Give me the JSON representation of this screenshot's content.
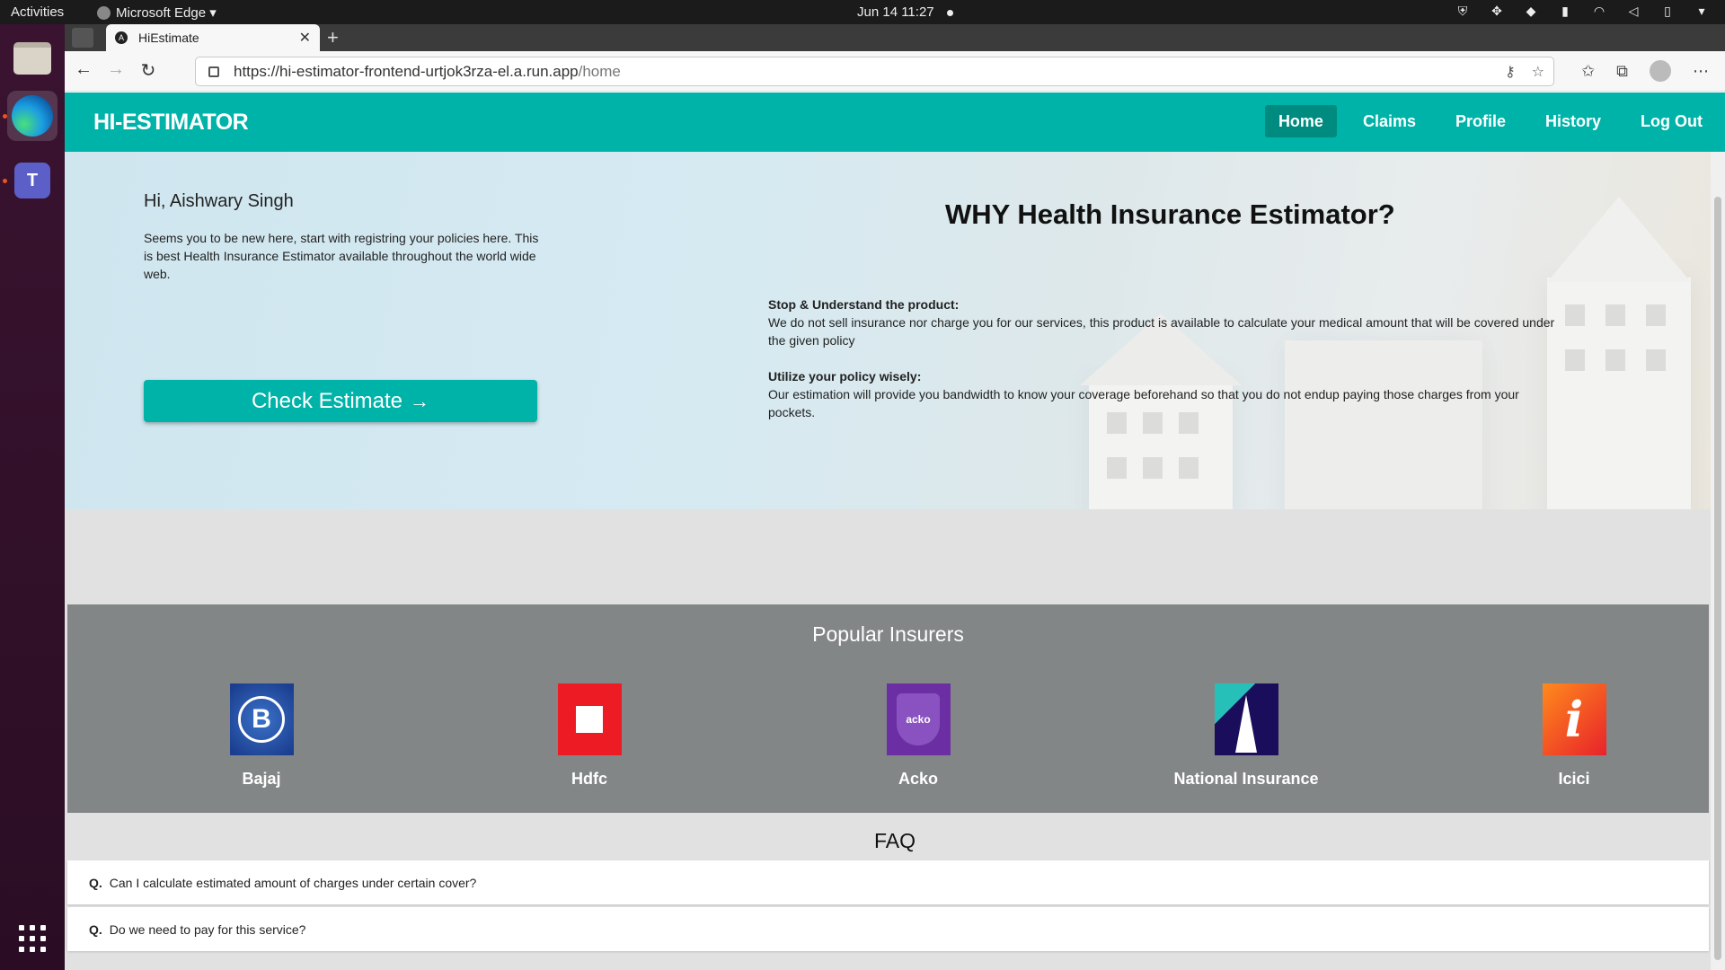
{
  "os": {
    "activities": "Activities",
    "app_menu": "Microsoft Edge ▾",
    "clock": "Jun 14  11:27"
  },
  "browser": {
    "tab_title": "HiEstimate",
    "url_host": "https://hi-estimator-frontend-urtjok3rza-el.a.run.app",
    "url_path": "/home"
  },
  "app": {
    "brand": "HI-ESTIMATOR",
    "nav": [
      "Home",
      "Claims",
      "Profile",
      "History",
      "Log Out"
    ],
    "active_nav": "Home",
    "accent_color": "#00b3a8"
  },
  "hero": {
    "greeting": "Hi, Aishwary Singh",
    "intro": "Seems you to be new here, start with registring your policies here. This is best Health Insurance Estimator available throughout the world wide web.",
    "cta_label": "Check Estimate",
    "why_title": "WHY Health Insurance Estimator?",
    "points": [
      {
        "heading": "Stop & Understand the product:",
        "text": "We do not sell insurance nor charge you for our services, this product is available to calculate your medical amount that will be covered under the given policy"
      },
      {
        "heading": "Utilize your policy wisely:",
        "text": "Our estimation will provide you bandwidth to know your coverage beforehand so that you do not endup paying those charges from your pockets."
      }
    ]
  },
  "insurers": {
    "title": "Popular Insurers",
    "items": [
      {
        "name": "Bajaj",
        "icon": "bajaj-logo-icon"
      },
      {
        "name": "Hdfc",
        "icon": "hdfc-logo-icon"
      },
      {
        "name": "Acko",
        "icon": "acko-logo-icon",
        "logo_text": "acko"
      },
      {
        "name": "National Insurance",
        "icon": "national-insurance-logo-icon"
      },
      {
        "name": "Icici",
        "icon": "icici-logo-icon"
      }
    ]
  },
  "faq": {
    "title": "FAQ",
    "q_prefix": "Q.",
    "items": [
      "Can I calculate estimated amount of charges under certain cover?",
      "Do we need to pay for this service?"
    ]
  }
}
